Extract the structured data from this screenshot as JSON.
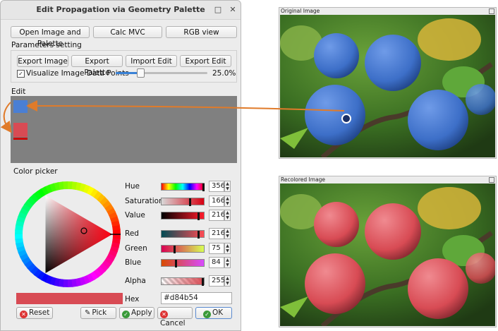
{
  "window": {
    "title": "Edit Propagation via Geometry Palette",
    "min": "–",
    "max": "□",
    "close": "✕"
  },
  "toolbar": {
    "open": "Open Image and Palette",
    "mvc": "Calc MVC",
    "rgb": "RGB view"
  },
  "params": {
    "heading": "Parameters setting",
    "export_image": "Export Image",
    "export_palette": "Export Palette",
    "import_edit": "Import Edit",
    "export_edit": "Export Edit",
    "visualize_label": "Visualize Image Data Points",
    "visualize_checked": true,
    "slider_value": "25.0%"
  },
  "edit": {
    "heading": "Edit",
    "swatch_top": "#4a7fd4",
    "swatch_bottom": "#d84b54"
  },
  "picker": {
    "heading": "Color picker",
    "hue_label": "Hue",
    "hue": "356",
    "sat_label": "Saturation",
    "sat": "166",
    "val_label": "Value",
    "val": "216",
    "red_label": "Red",
    "red": "216",
    "green_label": "Green",
    "green": "75",
    "blue_label": "Blue",
    "blue": "84",
    "alpha_label": "Alpha",
    "alpha": "255",
    "hex_label": "Hex",
    "hex": "#d84b54",
    "current_color": "#d84b54",
    "reset": "Reset",
    "pick": "Pick",
    "apply": "Apply",
    "cancel": "Cancel",
    "ok": "OK"
  },
  "original": {
    "title": "Original Image"
  },
  "recolored": {
    "title": "Recolored Image"
  },
  "colors": {
    "accent": "#e07b2a",
    "orange_arrow": "#e07b2a"
  }
}
